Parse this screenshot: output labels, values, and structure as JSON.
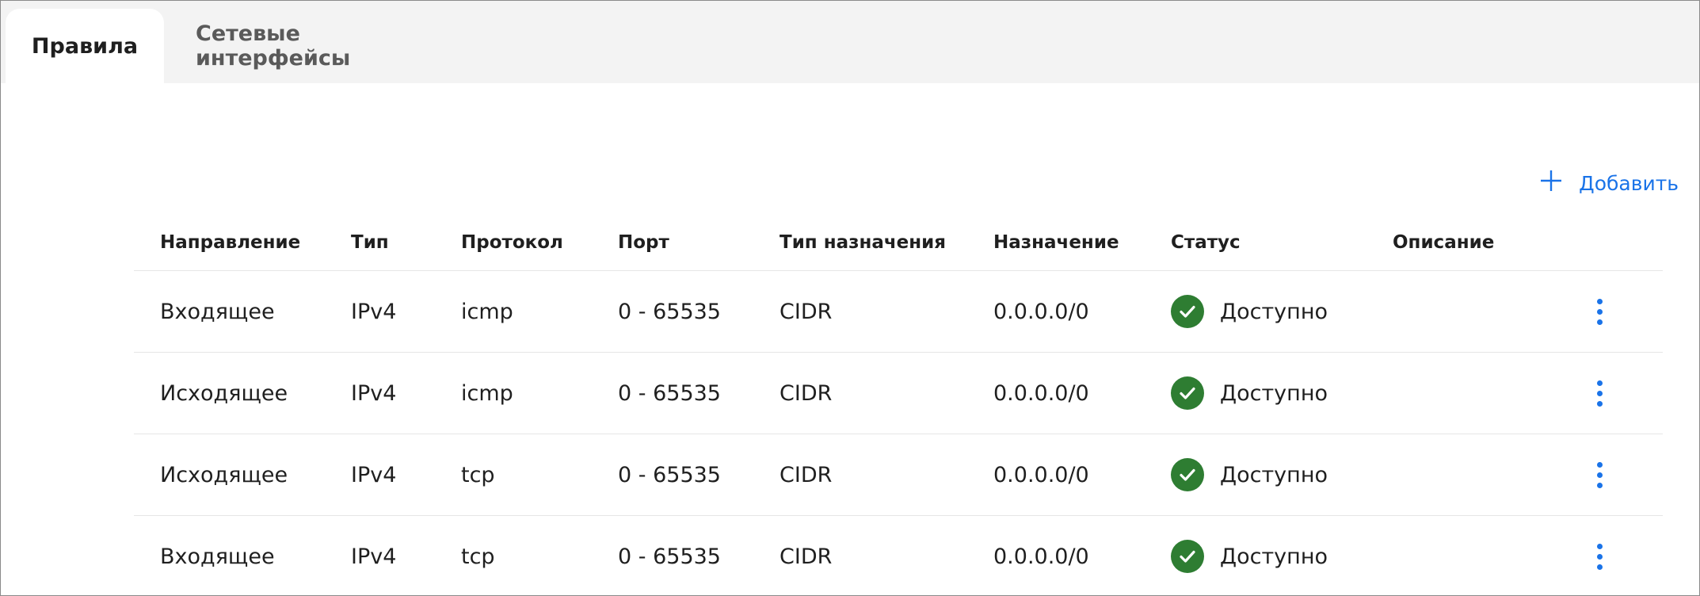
{
  "tabs": [
    {
      "label": "Правила",
      "active": true
    },
    {
      "label": "Сетевые интерфейсы",
      "active": false
    }
  ],
  "toolbar": {
    "add_label": "Добавить"
  },
  "table": {
    "columns": [
      "Направление",
      "Тип",
      "Протокол",
      "Порт",
      "Тип назначения",
      "Назначение",
      "Статус",
      "Описание"
    ],
    "rows": [
      {
        "direction": "Входящее",
        "type": "IPv4",
        "protocol": "icmp",
        "port": "0 - 65535",
        "dest_type": "CIDR",
        "destination": "0.0.0.0/0",
        "status": "Доступно",
        "description": ""
      },
      {
        "direction": "Исходящее",
        "type": "IPv4",
        "protocol": "icmp",
        "port": "0 - 65535",
        "dest_type": "CIDR",
        "destination": "0.0.0.0/0",
        "status": "Доступно",
        "description": ""
      },
      {
        "direction": "Исходящее",
        "type": "IPv4",
        "protocol": "tcp",
        "port": "0 - 65535",
        "dest_type": "CIDR",
        "destination": "0.0.0.0/0",
        "status": "Доступно",
        "description": ""
      },
      {
        "direction": "Входящее",
        "type": "IPv4",
        "protocol": "tcp",
        "port": "0 - 65535",
        "dest_type": "CIDR",
        "destination": "0.0.0.0/0",
        "status": "Доступно",
        "description": ""
      }
    ]
  },
  "icons": {
    "add": "plus-icon",
    "status_ok": "check-circle-icon",
    "row_menu": "more-vertical-icon"
  },
  "colors": {
    "accent": "#1a73e8",
    "status_ok": "#2e7d32",
    "tabbar_bg": "#f3f3f3"
  }
}
